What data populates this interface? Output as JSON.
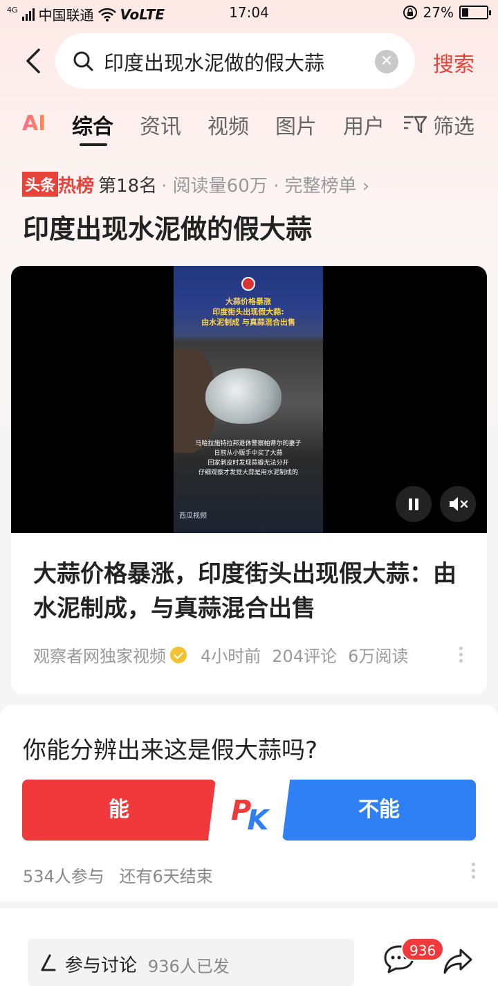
{
  "status_bar": {
    "network": "4G",
    "carrier": "中国联通",
    "volte": "VoLTE",
    "time": "17:04",
    "battery": "27%",
    "battery_level": 0.27
  },
  "search": {
    "query": "印度出现水泥做的假大蒜",
    "button_label": "搜索"
  },
  "tabs": {
    "ai": "AI",
    "items": [
      "综合",
      "资讯",
      "视频",
      "图片",
      "用户"
    ],
    "filter": "筛选",
    "active": "综合"
  },
  "hot": {
    "brand_1": "头条",
    "brand_2": "热榜",
    "rank": "第18名",
    "meta": "· 阅读量60万 · 完整榜单 ›"
  },
  "topic_title": "印度出现水泥做的假大蒜",
  "video": {
    "caption_1": "大蒜价格暴涨",
    "caption_2": "印度街头出现假大蒜:",
    "caption_3": "由水泥制成 与真蒜混合出售",
    "subtitle_1": "马哈拉施特拉邦退休警察帕蒂尔的妻子",
    "subtitle_2": "日前从小贩手中买了大蒜",
    "subtitle_3": "回家剥皮时发现蒜瓣无法分开",
    "subtitle_4": "仔细观察才发觉大蒜是用水泥制成的",
    "watermark": "西瓜视频"
  },
  "article": {
    "title": "大蒜价格暴涨，印度街头出现假大蒜：由水泥制成，与真蒜混合出售",
    "source": "观察者网独家视频",
    "time": "4小时前",
    "comments": "204评论",
    "reads": "6万阅读"
  },
  "pk": {
    "question": "你能分辨出来这是假大蒜吗?",
    "yes_label": "能",
    "no_label": "不能",
    "vs_p": "P",
    "vs_k": "K",
    "participants": "534人参与",
    "ends": "还有6天结束"
  },
  "bottom": {
    "discuss_label": "参与讨论",
    "discuss_count": "936人已发",
    "comment_badge": "936"
  },
  "colors": {
    "accent_red": "#e8433a",
    "pk_red": "#f1393b",
    "pk_blue": "#2f7ff5"
  }
}
